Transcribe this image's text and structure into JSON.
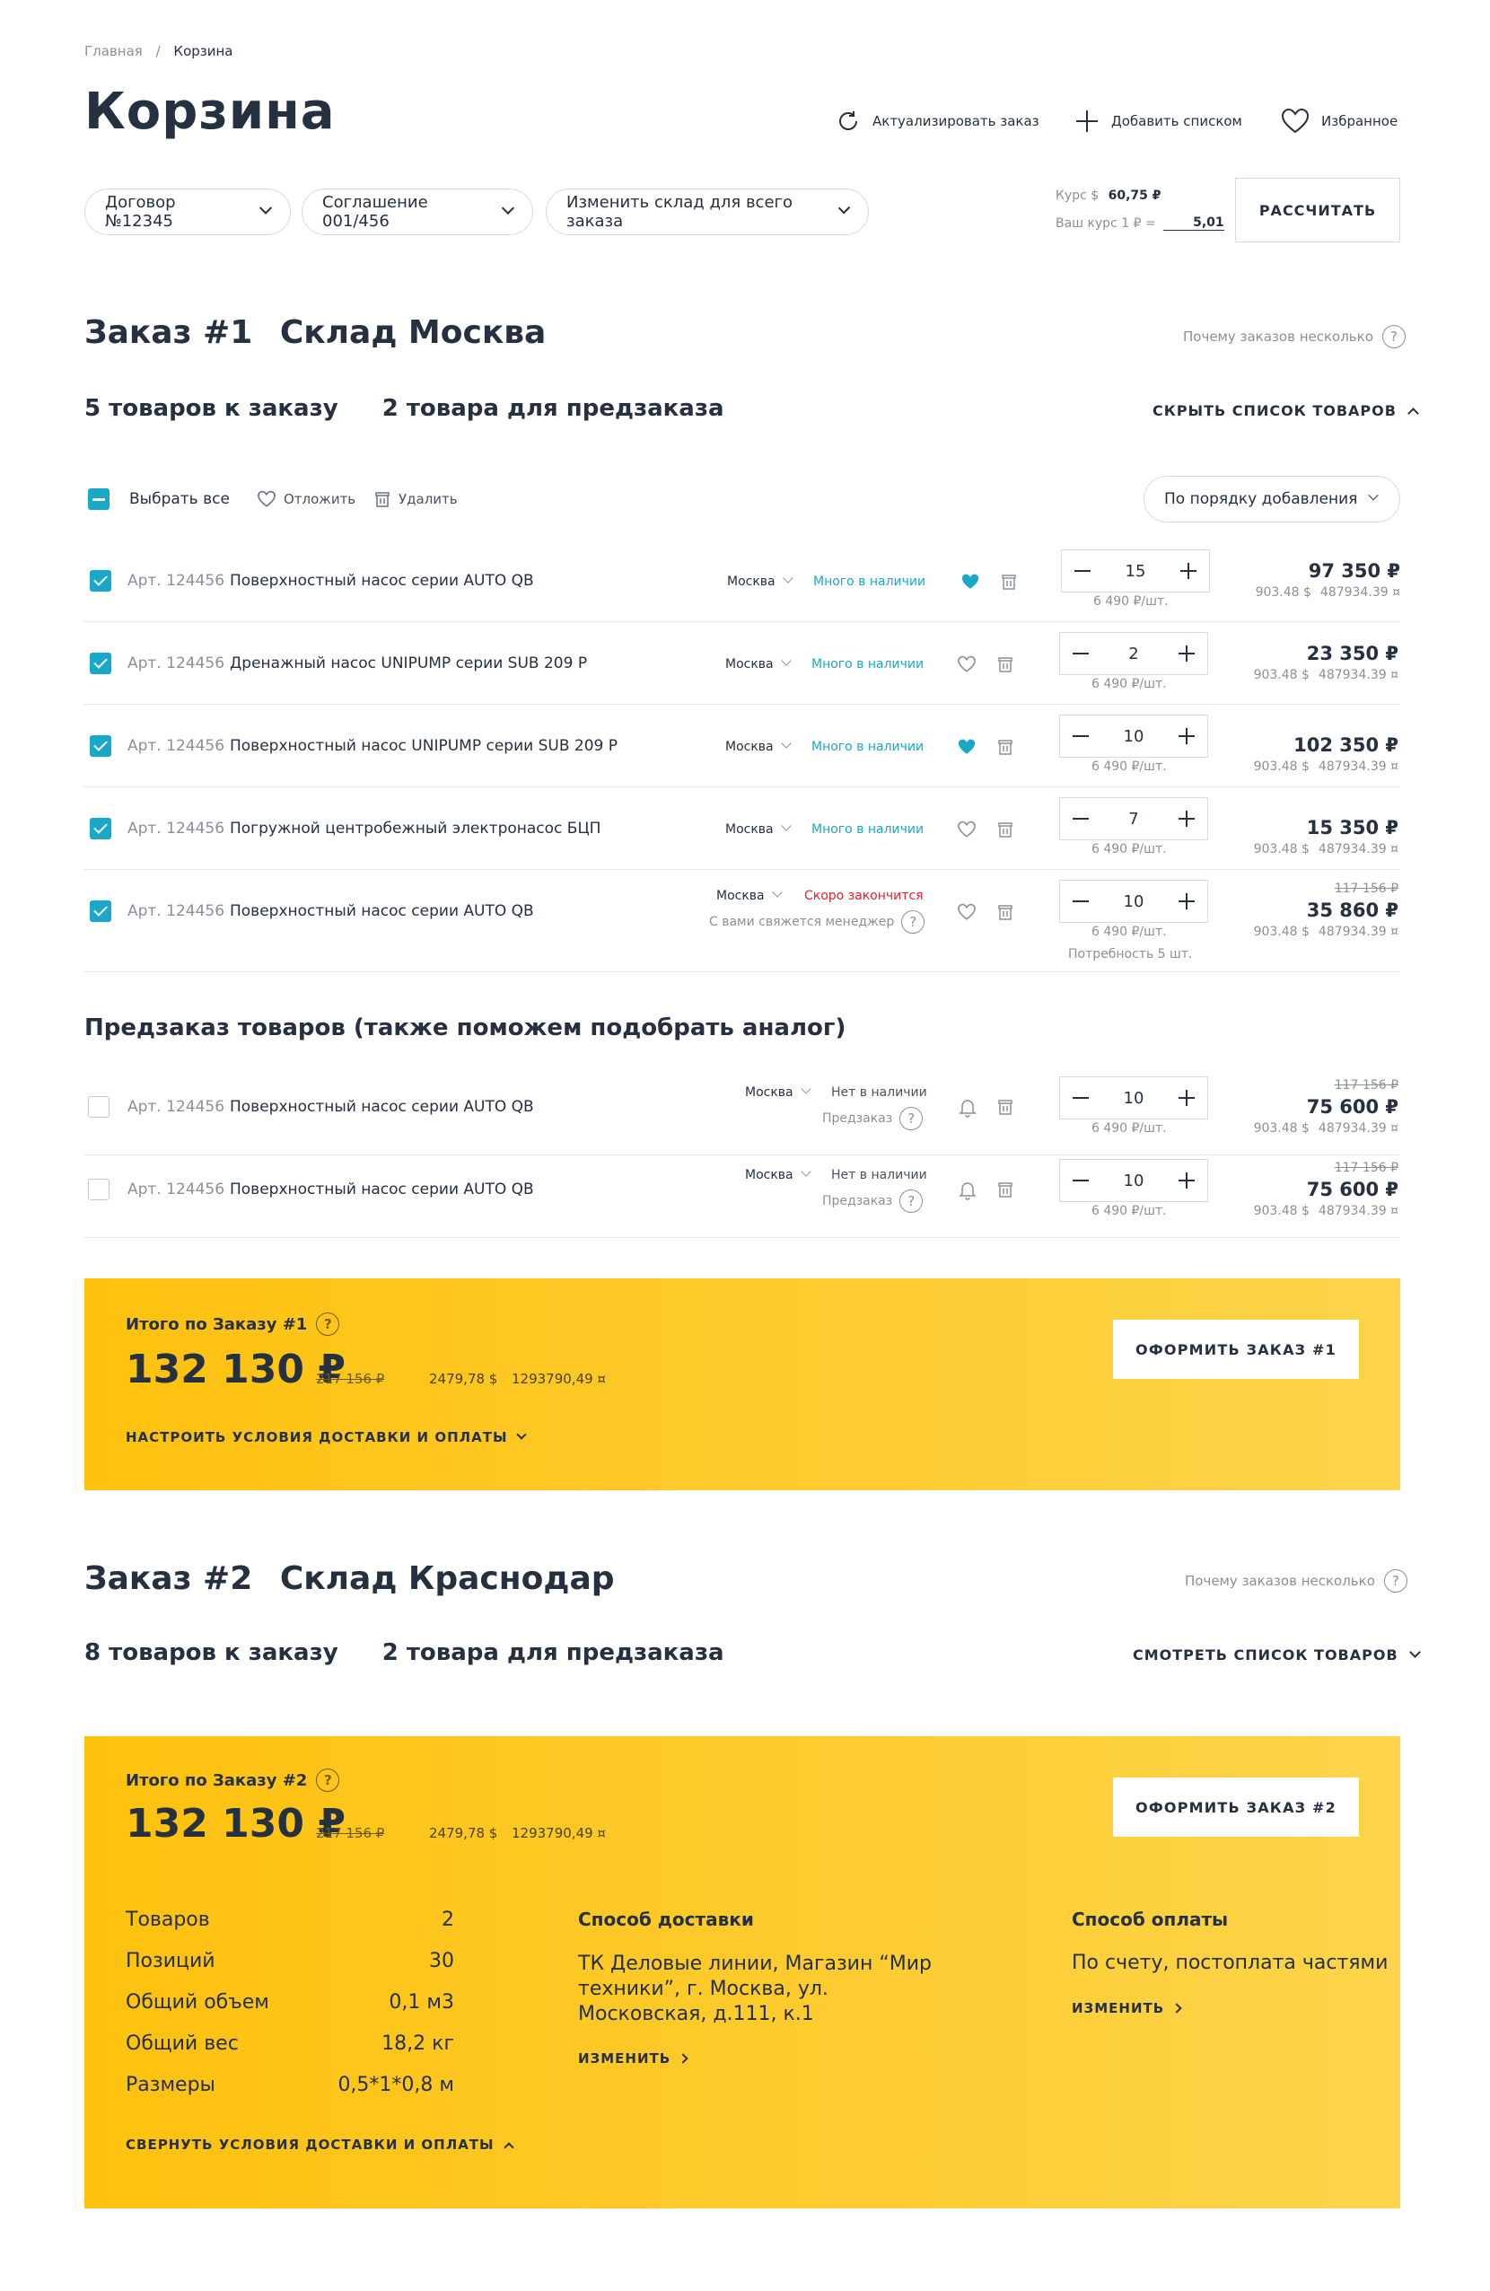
{
  "breadcrumb": {
    "home": "Главная",
    "separator": "/",
    "current": "Корзина"
  },
  "page_title": "Корзина",
  "header_actions": {
    "refresh": "Актуализировать заказ",
    "add_list": "Добавить списком",
    "favorites": "Избранное"
  },
  "filters": {
    "contract": "Договор №12345",
    "agreement": "Соглашение 001/456",
    "warehouse": "Изменить склад для всего заказа"
  },
  "rates": {
    "usd_label": "Курс $",
    "usd_value": "60,75 ₽",
    "own_label": "Ваш курс 1 ₽ =",
    "own_value": "5,01"
  },
  "calculate_button": "РАССЧИТАТЬ",
  "order1": {
    "number": "Заказ #1",
    "warehouse": "Склад Москва",
    "why_many": "Почему заказов несколько",
    "count_order": "5 товаров к заказу",
    "count_preorder": "2 товара для предзаказа",
    "toggle_list": "СКРЫТЬ СПИСОК ТОВАРОВ",
    "toolbar": {
      "select_all": "Выбрать все",
      "postpone": "Отложить",
      "delete": "Удалить",
      "sort": "По порядку добавления"
    },
    "items": [
      {
        "art": "Арт. 124456",
        "name": "Поверхностный насос серии AUTO QB",
        "city": "Москва",
        "stock": "Много в наличии",
        "qty": "15",
        "unit_price": "6 490 ₽/шт.",
        "price": "97 350 ₽",
        "usd": "903.48 $",
        "cur": "487934.39 ¤"
      },
      {
        "art": "Арт. 124456",
        "name": "Дренажный насос UNIPUMP серии SUB 209 P",
        "city": "Москва",
        "stock": "Много в наличии",
        "qty": "2",
        "unit_price": "6 490 ₽/шт.",
        "price": "23 350 ₽",
        "usd": "903.48 $",
        "cur": "487934.39 ¤"
      },
      {
        "art": "Арт. 124456",
        "name": "Поверхностный насос UNIPUMP серии SUB 209 P",
        "city": "Москва",
        "stock": "Много в наличии",
        "qty": "10",
        "unit_price": "6 490 ₽/шт.",
        "price": "102 350 ₽",
        "usd": "903.48 $",
        "cur": "487934.39 ¤"
      },
      {
        "art": "Арт. 124456",
        "name": "Погружной центробежный электронасос БЦП",
        "city": "Москва",
        "stock": "Много в наличии",
        "qty": "7",
        "unit_price": "6 490 ₽/шт.",
        "price": "15 350 ₽",
        "usd": "903.48 $",
        "cur": "487934.39 ¤"
      },
      {
        "art": "Арт. 124456",
        "name": "Поверхностный насос серии AUTO QB",
        "city": "Москва",
        "stock": "Скоро закончится",
        "manager_note": "С вами свяжется менеджер",
        "qty": "10",
        "unit_price": "6 490 ₽/шт.",
        "need": "Потребность 5 шт.",
        "old_price": "117 156 ₽",
        "price": "35 860 ₽",
        "usd": "903.48 $",
        "cur": "487934.39 ¤"
      }
    ],
    "preorder_title": "Предзаказ товаров (также поможем подобрать аналог)",
    "preorder_items": [
      {
        "art": "Арт. 124456",
        "name": "Поверхностный насос серии AUTO QB",
        "city": "Москва",
        "stock": "Нет в наличии",
        "note": "Предзаказ",
        "qty": "10",
        "unit_price": "6 490 ₽/шт.",
        "old_price": "117 156 ₽",
        "price": "75 600 ₽",
        "usd": "903.48 $",
        "cur": "487934.39 ¤"
      },
      {
        "art": "Арт. 124456",
        "name": "Поверхностный насос серии AUTO QB",
        "city": "Москва",
        "stock": "Нет в наличии",
        "note": "Предзаказ",
        "qty": "10",
        "unit_price": "6 490 ₽/шт.",
        "old_price": "117 156 ₽",
        "price": "75 600 ₽",
        "usd": "903.48 $",
        "cur": "487934.39 ¤"
      }
    ],
    "total": {
      "label": "Итого по Заказу #1",
      "sum": "132 130 ₽",
      "old_sum": "217 156 ₽",
      "usd": "2479,78 $",
      "cur": "1293790,49 ¤",
      "delivery_toggle": "НАСТРОИТЬ УСЛОВИЯ ДОСТАВКИ И ОПЛАТЫ",
      "button": "ОФОРМИТЬ ЗАКАЗ #1"
    }
  },
  "order2": {
    "number": "Заказ #2",
    "warehouse": "Склад Краснодар",
    "why_many": "Почему заказов несколько",
    "count_order": "8 товаров к заказу",
    "count_preorder": "2 товара для предзаказа",
    "toggle_list": "СМОТРЕТЬ СПИСОК ТОВАРОВ",
    "total": {
      "label": "Итого по Заказу #2",
      "sum": "132 130 ₽",
      "old_sum": "217 156 ₽",
      "usd": "2479,78 $",
      "cur": "1293790,49 ¤",
      "button": "ОФОРМИТЬ ЗАКАЗ #2",
      "summary": [
        {
          "label": "Товаров",
          "value": "2"
        },
        {
          "label": "Позиций",
          "value": "30"
        },
        {
          "label": "Общий объем",
          "value": "0,1 м3"
        },
        {
          "label": "Общий вес",
          "value": "18,2 кг"
        },
        {
          "label": "Размеры",
          "value": "0,5*1*0,8 м"
        }
      ],
      "delivery_title": "Способ доставки",
      "delivery_text": "ТК Деловые линии, Магазин “Мир техники”, г. Москва, ул. Московская, д.111, к.1",
      "delivery_change": "ИЗМЕНИТЬ",
      "payment_title": "Способ оплаты",
      "payment_text": "По счету, постоплата частями",
      "payment_change": "ИЗМЕНИТЬ",
      "collapse": "СВЕРНУТЬ УСЛОВИЯ ДОСТАВКИ И ОПЛАТЫ"
    }
  },
  "colors": {
    "accent": "#1aa8c9",
    "yellow": "#fec10e",
    "text": "#253040",
    "muted": "#8a9099",
    "red": "#e3232f"
  }
}
